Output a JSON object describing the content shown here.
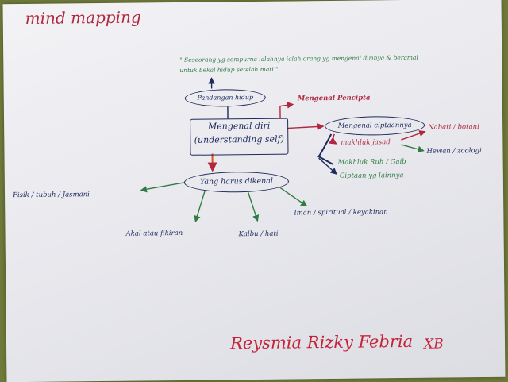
{
  "title": "mind mapping",
  "quote": "\" Seseorang yg sempurna ialahnya ialah orang yg mengenal dirinya & beramal untuk bekal hidup setelah mati \"",
  "central_node": {
    "line1": "Mengenal diri",
    "line2": "(understanding self)"
  },
  "nodes": {
    "pandangan_hidup": "Pandangan hidup",
    "mengenal_pencipta": "Mengenal Pencipta",
    "mengenal_ciptaan": "Mengenal ciptaannya",
    "makhluk_jasad": "makhluk jasad",
    "nabati": "Nabati / botani",
    "hewan": "Hewan / zoologi",
    "makhluk_ruh": "Makhluk Ruh / Gaib",
    "ciptaan_lainnya": "Ciptaan yg lainnya",
    "yang_harus_dikenal": "Yang harus dikenal",
    "fisik": "Fisik / tubuh / Jasmani",
    "akal": "Akal atau fikiran",
    "kalbu": "Kalbu / hati",
    "iman": "Iman / spiritual / keyakinan"
  },
  "signature": "Reysmia Rizky Febria",
  "class_label": "XB",
  "colors": {
    "navy": "#1d2a5e",
    "red": "#b02840",
    "green": "#2f7d45",
    "orange": "#e0501e",
    "signature": "#c42238"
  }
}
